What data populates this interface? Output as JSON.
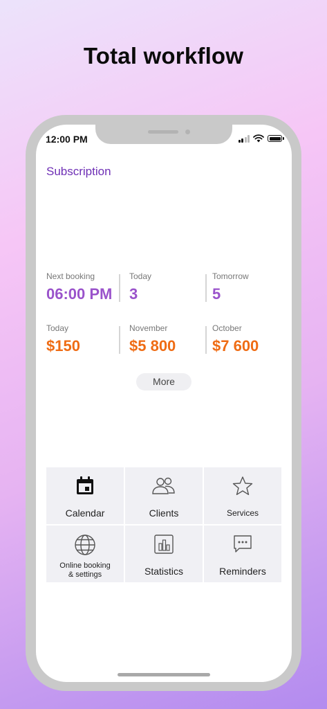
{
  "headline": "Total workflow",
  "status_bar": {
    "time": "12:00 PM"
  },
  "subscription_label": "Subscription",
  "stats_top": [
    {
      "label": "Next booking",
      "value": "06:00 PM"
    },
    {
      "label": "Today",
      "value": "3"
    },
    {
      "label": "Tomorrow",
      "value": "5"
    }
  ],
  "stats_revenue": [
    {
      "label": "Today",
      "value": "$150"
    },
    {
      "label": "November",
      "value": "$5 800"
    },
    {
      "label": "October",
      "value": "$7 600"
    }
  ],
  "more_label": "More",
  "menu": [
    {
      "label": "Calendar",
      "icon": "calendar-icon"
    },
    {
      "label": "Clients",
      "icon": "clients-icon"
    },
    {
      "label": "Services",
      "icon": "star-icon"
    },
    {
      "label": "Online booking\n& settings",
      "icon": "globe-icon"
    },
    {
      "label": "Statistics",
      "icon": "chart-icon"
    },
    {
      "label": "Reminders",
      "icon": "message-icon"
    }
  ],
  "colors": {
    "accent_purple": "#9a53cb",
    "accent_orange": "#ef6c14",
    "link_purple": "#6e2fb5"
  }
}
